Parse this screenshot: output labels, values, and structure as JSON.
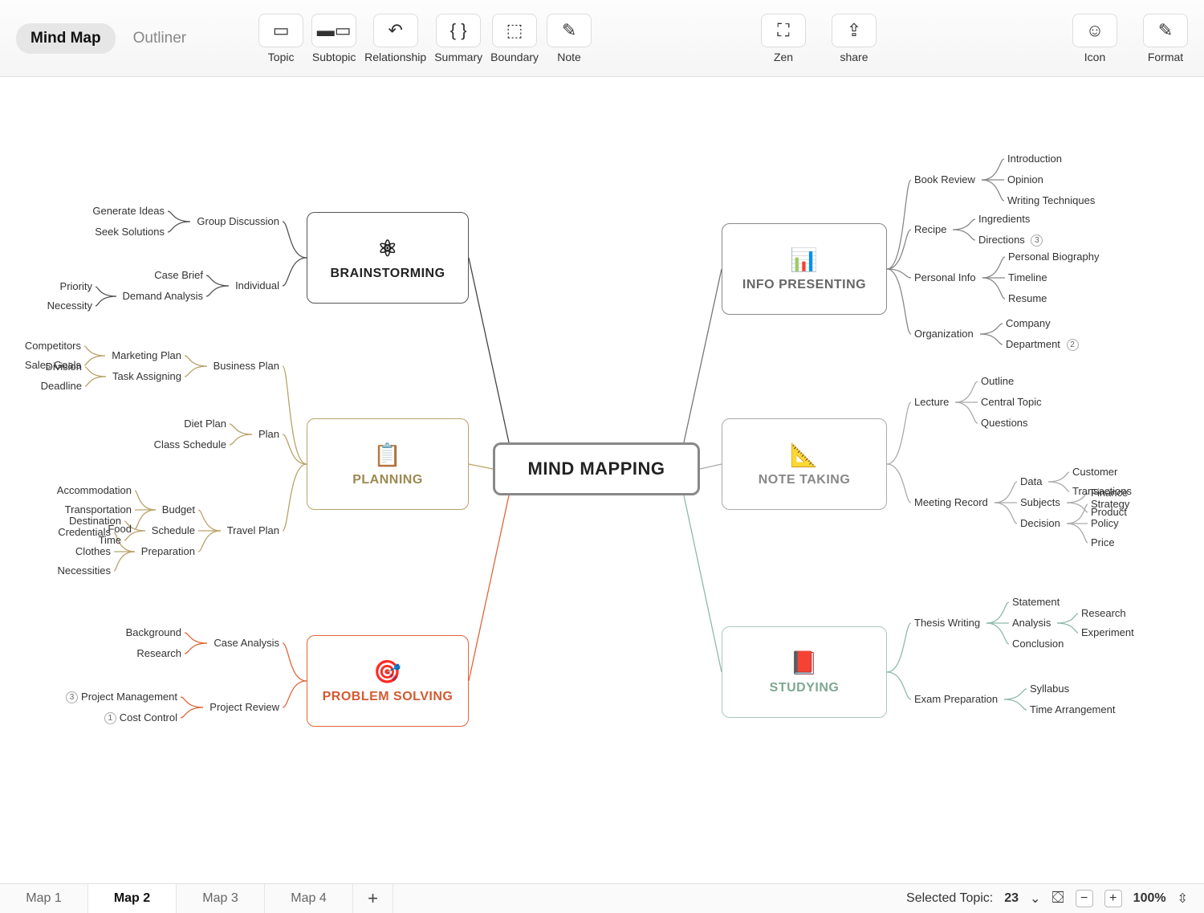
{
  "toolbar": {
    "views": [
      "Mind Map",
      "Outliner"
    ],
    "tools": [
      "Topic",
      "Subtopic",
      "Relationship",
      "Summary",
      "Boundary",
      "Note"
    ],
    "right": [
      "Zen",
      "share"
    ],
    "far": [
      "Icon",
      "Format"
    ]
  },
  "central": "MIND MAPPING",
  "branches": {
    "brainstorming": {
      "label": "BRAINSTORMING",
      "color": "#555",
      "sub": [
        {
          "label": "Group Discussion",
          "kids": [
            {
              "t": "Generate Ideas"
            },
            {
              "t": "Seek Solutions"
            }
          ]
        },
        {
          "label": "Individual",
          "kids": [
            {
              "t": "Case Brief"
            },
            {
              "t": "Demand Analysis",
              "kids": [
                {
                  "t": "Priority"
                },
                {
                  "t": "Necessity"
                }
              ]
            }
          ]
        }
      ]
    },
    "planning": {
      "label": "PLANNING",
      "color": "#b9a36a",
      "sub": [
        {
          "label": "Business Plan",
          "kids": [
            {
              "t": "Marketing Plan",
              "kids": [
                {
                  "t": "Competitors"
                },
                {
                  "t": "Sales Goals"
                }
              ]
            },
            {
              "t": "Task Assigning",
              "kids": [
                {
                  "t": "Division"
                },
                {
                  "t": "Deadline"
                }
              ]
            }
          ]
        },
        {
          "label": "Plan",
          "kids": [
            {
              "t": "Diet Plan"
            },
            {
              "t": "Class Schedule"
            }
          ]
        },
        {
          "label": "Travel Plan",
          "kids": [
            {
              "t": "Budget",
              "kids": [
                {
                  "t": "Accommodation"
                },
                {
                  "t": "Transportation"
                },
                {
                  "t": "Food"
                }
              ]
            },
            {
              "t": "Schedule",
              "kids": [
                {
                  "t": "Destination"
                },
                {
                  "t": "Time"
                }
              ]
            },
            {
              "t": "Preparation",
              "kids": [
                {
                  "t": "Credentials"
                },
                {
                  "t": "Clothes"
                },
                {
                  "t": "Necessities"
                }
              ]
            }
          ]
        }
      ]
    },
    "problem": {
      "label": "PROBLEM SOLVING",
      "color": "#e0663a",
      "sub": [
        {
          "label": "Case Analysis",
          "kids": [
            {
              "t": "Background"
            },
            {
              "t": "Research"
            }
          ]
        },
        {
          "label": "Project Review",
          "kids": [
            {
              "t": "Project Management",
              "badge": "3"
            },
            {
              "t": "Cost Control",
              "badge": "1"
            }
          ]
        }
      ]
    },
    "info": {
      "label": "INFO PRESENTING",
      "color": "#7a7a7a",
      "sub": [
        {
          "label": "Book Review",
          "kids": [
            {
              "t": "Introduction"
            },
            {
              "t": "Opinion"
            },
            {
              "t": "Writing Techniques"
            }
          ]
        },
        {
          "label": "Recipe",
          "kids": [
            {
              "t": "Ingredients"
            },
            {
              "t": "Directions",
              "badge": "3"
            }
          ]
        },
        {
          "label": "Personal Info",
          "kids": [
            {
              "t": "Personal Biography"
            },
            {
              "t": "Timeline"
            },
            {
              "t": "Resume"
            }
          ]
        },
        {
          "label": "Organization",
          "kids": [
            {
              "t": "Company"
            },
            {
              "t": "Department",
              "badge": "2"
            }
          ]
        }
      ]
    },
    "note": {
      "label": "NOTE TAKING",
      "color": "#9a9a9a",
      "sub": [
        {
          "label": "Lecture",
          "kids": [
            {
              "t": "Outline"
            },
            {
              "t": "Central Topic"
            },
            {
              "t": "Questions"
            }
          ]
        },
        {
          "label": "Meeting Record",
          "kids": [
            {
              "t": "Data",
              "kids": [
                {
                  "t": "Customer"
                },
                {
                  "t": "Transactions"
                }
              ]
            },
            {
              "t": "Subjects",
              "kids": [
                {
                  "t": "Finance"
                },
                {
                  "t": "Product"
                }
              ]
            },
            {
              "t": "Decision",
              "kids": [
                {
                  "t": "Strategy"
                },
                {
                  "t": "Policy"
                },
                {
                  "t": "Price"
                }
              ]
            }
          ]
        }
      ]
    },
    "study": {
      "label": "STUDYING",
      "color": "#8fb9a8",
      "sub": [
        {
          "label": "Thesis Writing",
          "kids": [
            {
              "t": "Statement"
            },
            {
              "t": "Analysis",
              "kids": [
                {
                  "t": "Research"
                },
                {
                  "t": "Experiment"
                }
              ]
            },
            {
              "t": "Conclusion"
            }
          ]
        },
        {
          "label": "Exam Preparation",
          "kids": [
            {
              "t": "Syllabus"
            },
            {
              "t": "Time Arrangement"
            }
          ]
        }
      ]
    }
  },
  "tabs": [
    "Map 1",
    "Map 2",
    "Map 3",
    "Map 4"
  ],
  "activeTab": 1,
  "status": {
    "label": "Selected Topic:",
    "value": "23",
    "zoom": "100%"
  }
}
